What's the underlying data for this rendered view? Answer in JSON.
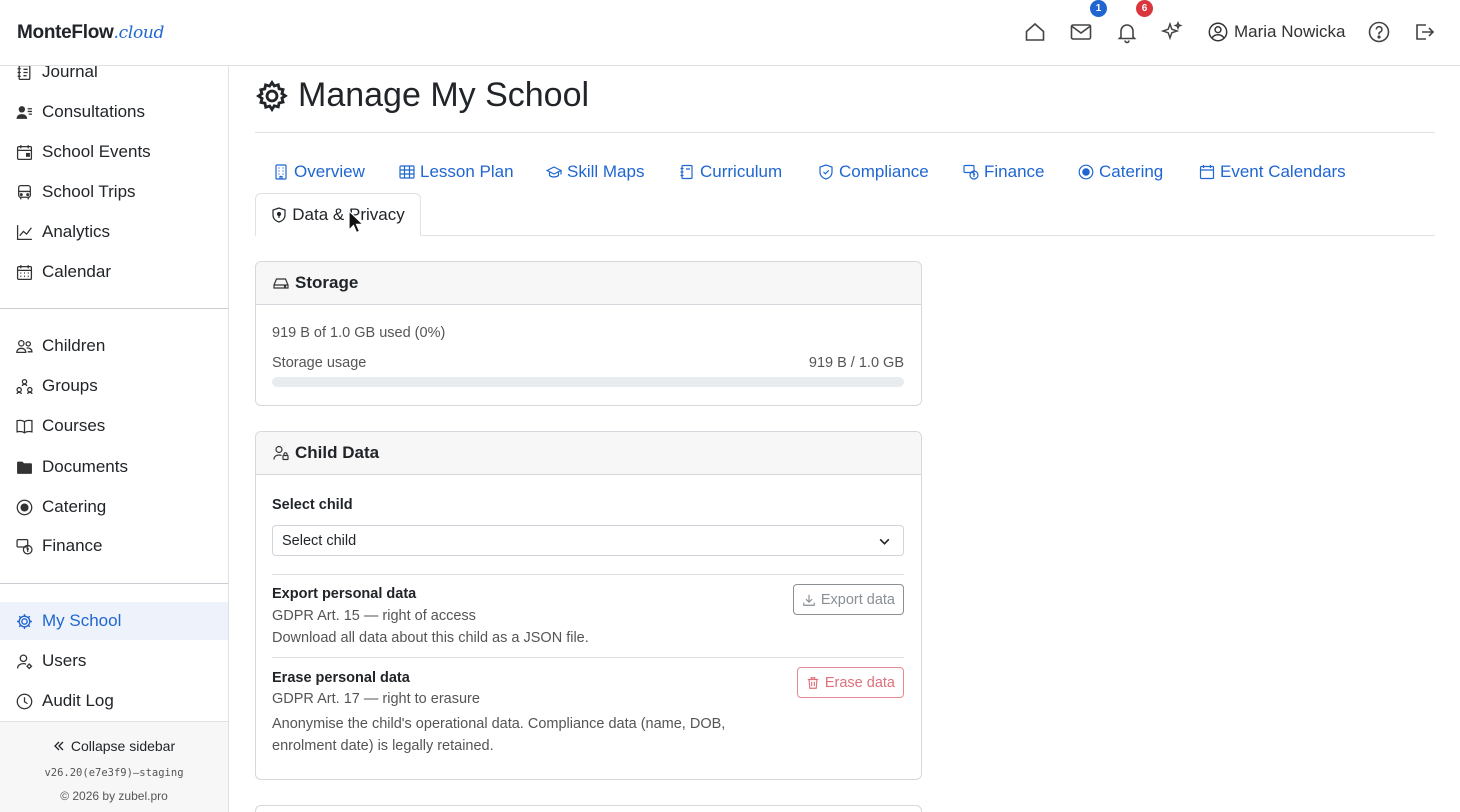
{
  "header": {
    "logo_main": "MonteFlow",
    "logo_suffix": ".cloud",
    "messages_badge": "1",
    "notifications_badge": "6",
    "user_name": "Maria Nowicka",
    "icons": [
      "home-icon",
      "mail-icon",
      "bell-icon",
      "sparkles-icon",
      "user-circle-icon",
      "help-icon",
      "logout-icon"
    ],
    "badge_colors": {
      "messages": "#1f66d1",
      "notifications": "#d9363e"
    }
  },
  "sidebar": {
    "group1": [
      {
        "label": "Journal",
        "icon": "journal-icon"
      },
      {
        "label": "Consultations",
        "icon": "people-icon"
      },
      {
        "label": "School Events",
        "icon": "calendar-event-icon"
      },
      {
        "label": "School Trips",
        "icon": "bus-icon"
      },
      {
        "label": "Analytics",
        "icon": "chart-line-icon"
      },
      {
        "label": "Calendar",
        "icon": "calendar-icon"
      }
    ],
    "group2": [
      {
        "label": "Children",
        "icon": "children-icon"
      },
      {
        "label": "Groups",
        "icon": "groups-icon"
      },
      {
        "label": "Courses",
        "icon": "book-icon"
      },
      {
        "label": "Documents",
        "icon": "folder-icon"
      },
      {
        "label": "Catering",
        "icon": "catering-icon"
      },
      {
        "label": "Finance",
        "icon": "finance-icon"
      }
    ],
    "group3": [
      {
        "label": "My School",
        "icon": "gear-icon",
        "active": true
      },
      {
        "label": "Users",
        "icon": "users-icon"
      },
      {
        "label": "Audit Log",
        "icon": "clock-icon"
      }
    ],
    "collapse_label": "Collapse sidebar",
    "version": "v26.20(e7e3f9)—staging",
    "copyright": "© 2026 by zubel.pro"
  },
  "page": {
    "title": "Manage My School",
    "tabs": [
      {
        "label": "Overview",
        "icon": "building-icon"
      },
      {
        "label": "Lesson Plan",
        "icon": "table-icon"
      },
      {
        "label": "Skill Maps",
        "icon": "mortarboard-icon"
      },
      {
        "label": "Curriculum",
        "icon": "journal-icon"
      },
      {
        "label": "Compliance",
        "icon": "shield-check-icon"
      },
      {
        "label": "Finance",
        "icon": "finance-icon"
      },
      {
        "label": "Catering",
        "icon": "catering-icon"
      },
      {
        "label": "Event Calendars",
        "icon": "calendar-icon"
      }
    ],
    "active_tab": {
      "label": "Data & Privacy",
      "icon": "shield-lock-icon"
    }
  },
  "storage": {
    "title": "Storage",
    "summary": "919 B of 1.0 GB used (0%)",
    "usage_label": "Storage usage",
    "usage_value": "919 B / 1.0 GB",
    "usage_percent": 0
  },
  "child_data": {
    "title": "Child Data",
    "select_label": "Select child",
    "select_value": "Select child",
    "export": {
      "title": "Export personal data",
      "subtitle": "GDPR Art. 15 — right of access",
      "description": "Download all data about this child as a JSON file.",
      "button": "Export data"
    },
    "erase": {
      "title": "Erase personal data",
      "subtitle": "GDPR Art. 17 — right to erasure",
      "description": "Anonymise the child's operational data. Compliance data (name, DOB, enrolment date) is legally retained.",
      "button": "Erase data"
    }
  }
}
